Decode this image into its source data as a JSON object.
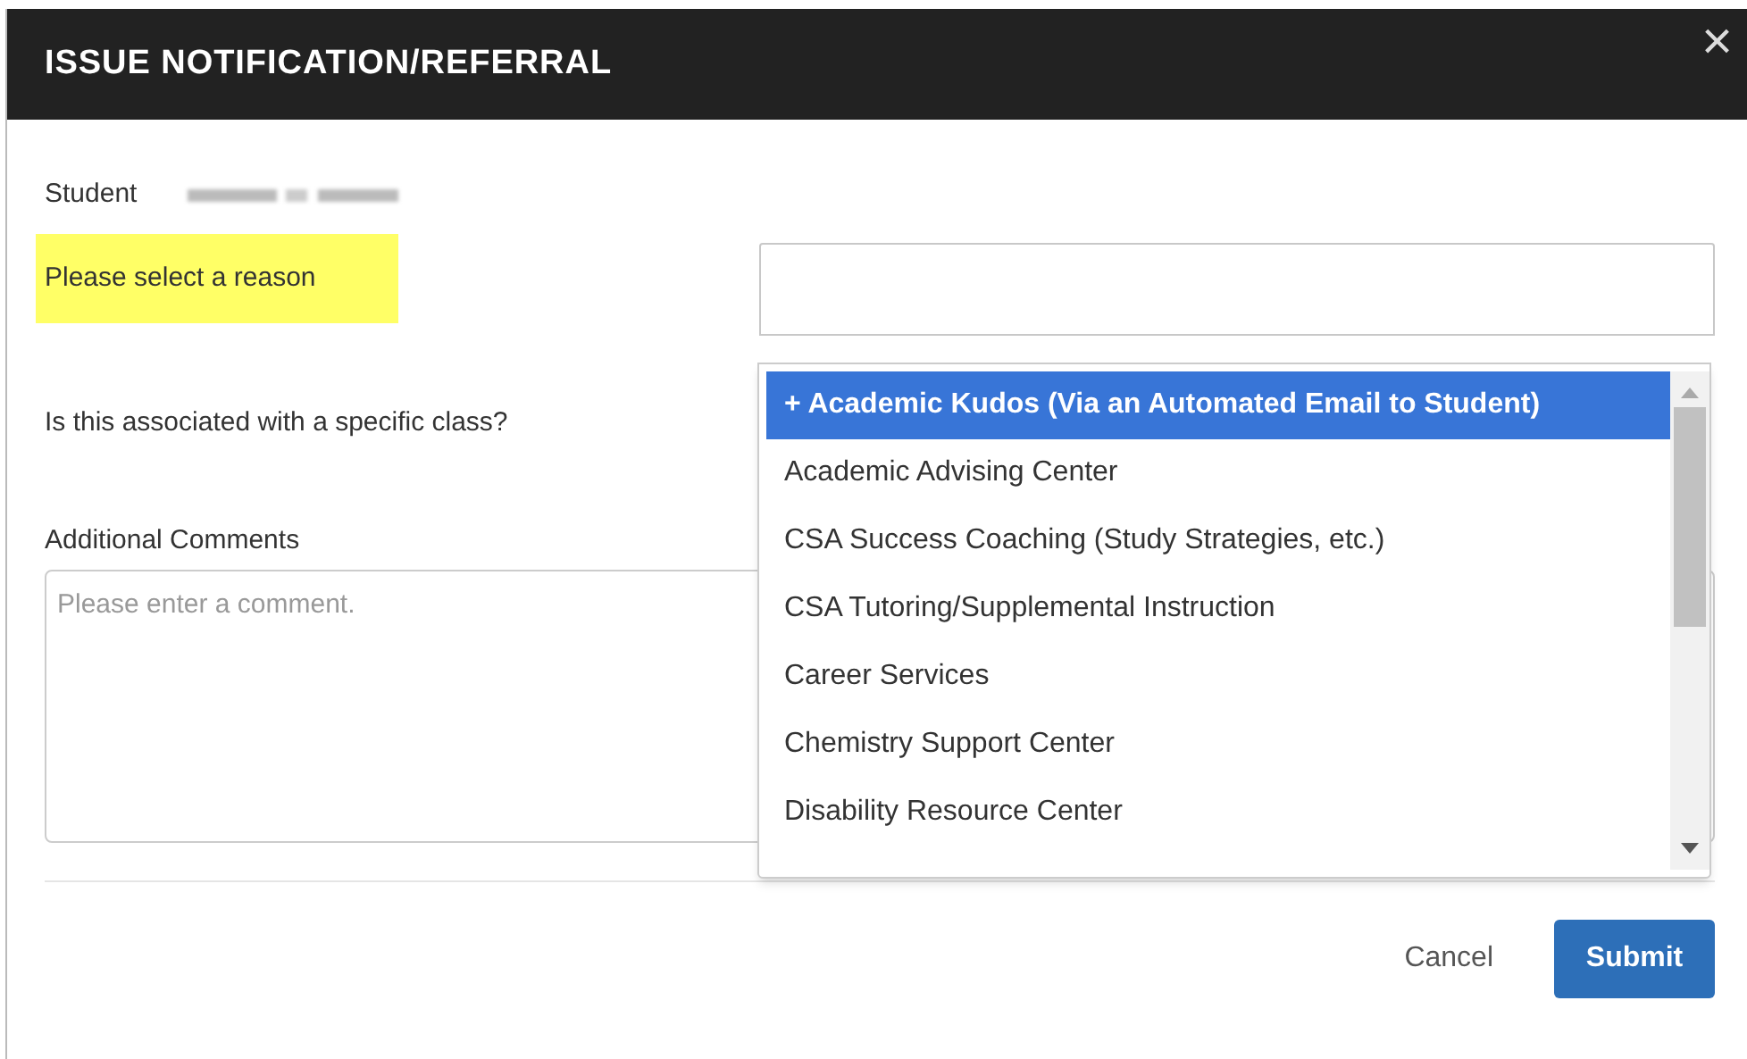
{
  "dialog": {
    "title": "ISSUE NOTIFICATION/REFERRAL",
    "close": "×"
  },
  "student": {
    "label": "Student"
  },
  "reason": {
    "label": "Please select a reason",
    "highlighted": true,
    "expanded": true,
    "options": [
      {
        "label": "+ Academic Kudos (Via an Automated Email to Student)",
        "selected": true
      },
      {
        "label": "Academic Advising Center",
        "selected": false
      },
      {
        "label": "CSA Success Coaching (Study Strategies, etc.)",
        "selected": false
      },
      {
        "label": "CSA Tutoring/Supplemental Instruction",
        "selected": false
      },
      {
        "label": "Career Services",
        "selected": false
      },
      {
        "label": "Chemistry Support Center",
        "selected": false
      },
      {
        "label": "Disability Resource Center",
        "selected": false
      }
    ]
  },
  "class_question": {
    "label": "Is this associated with a specific class?"
  },
  "comments": {
    "label": "Additional Comments",
    "placeholder": "Please enter a comment."
  },
  "buttons": [
    {
      "label": "Cancel",
      "kind": "link"
    },
    {
      "label": "Submit",
      "kind": "primary"
    }
  ]
}
